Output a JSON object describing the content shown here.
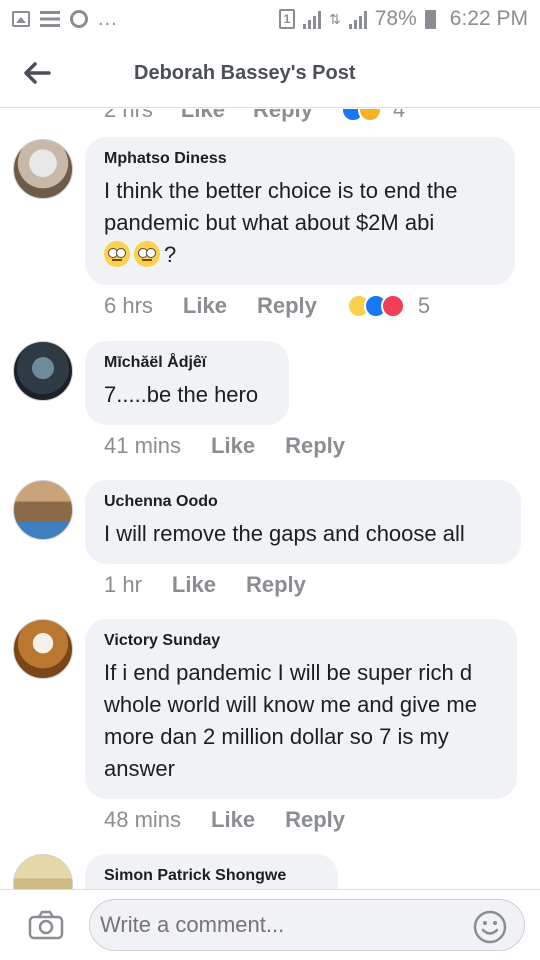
{
  "status_bar": {
    "battery": "78%",
    "time": "6:22 PM",
    "dots": "...",
    "sim_label": "1"
  },
  "header": {
    "title": "Deborah Bassey's Post"
  },
  "partial_previous": {
    "time": "2 hrs",
    "like": "Like",
    "reply": "Reply",
    "count": "4"
  },
  "comments": [
    {
      "author": "Mphatso Diness",
      "text": "I think the better choice is to end the pandemic but what about $2M abi",
      "suffix": "?",
      "time": "6 hrs",
      "like": "Like",
      "reply": "Reply",
      "reaction_count": "5",
      "reactions": [
        "haha",
        "like",
        "love"
      ]
    },
    {
      "author": "Mīchăël Ådjêï",
      "text": "7.....be the hero",
      "time": "41 mins",
      "like": "Like",
      "reply": "Reply"
    },
    {
      "author": "Uchenna Oodo",
      "text": "I will remove the gaps and choose all",
      "time": "1 hr",
      "like": "Like",
      "reply": "Reply"
    },
    {
      "author": "Victory Sunday",
      "text": "If i end pandemic I will be super rich d whole world will know me and give me more dan 2 million dollar so 7 is my answer",
      "time": "48 mins",
      "like": "Like",
      "reply": "Reply"
    },
    {
      "author": "Simon Patrick Shongwe"
    }
  ],
  "composer": {
    "placeholder": "Write a comment..."
  },
  "colors": {
    "bubble": "#f0f2f5",
    "meta_text": "#8a8d91",
    "like_blue": "#1877f2",
    "love_red": "#f33e58",
    "haha_yellow": "#fbd14b"
  }
}
